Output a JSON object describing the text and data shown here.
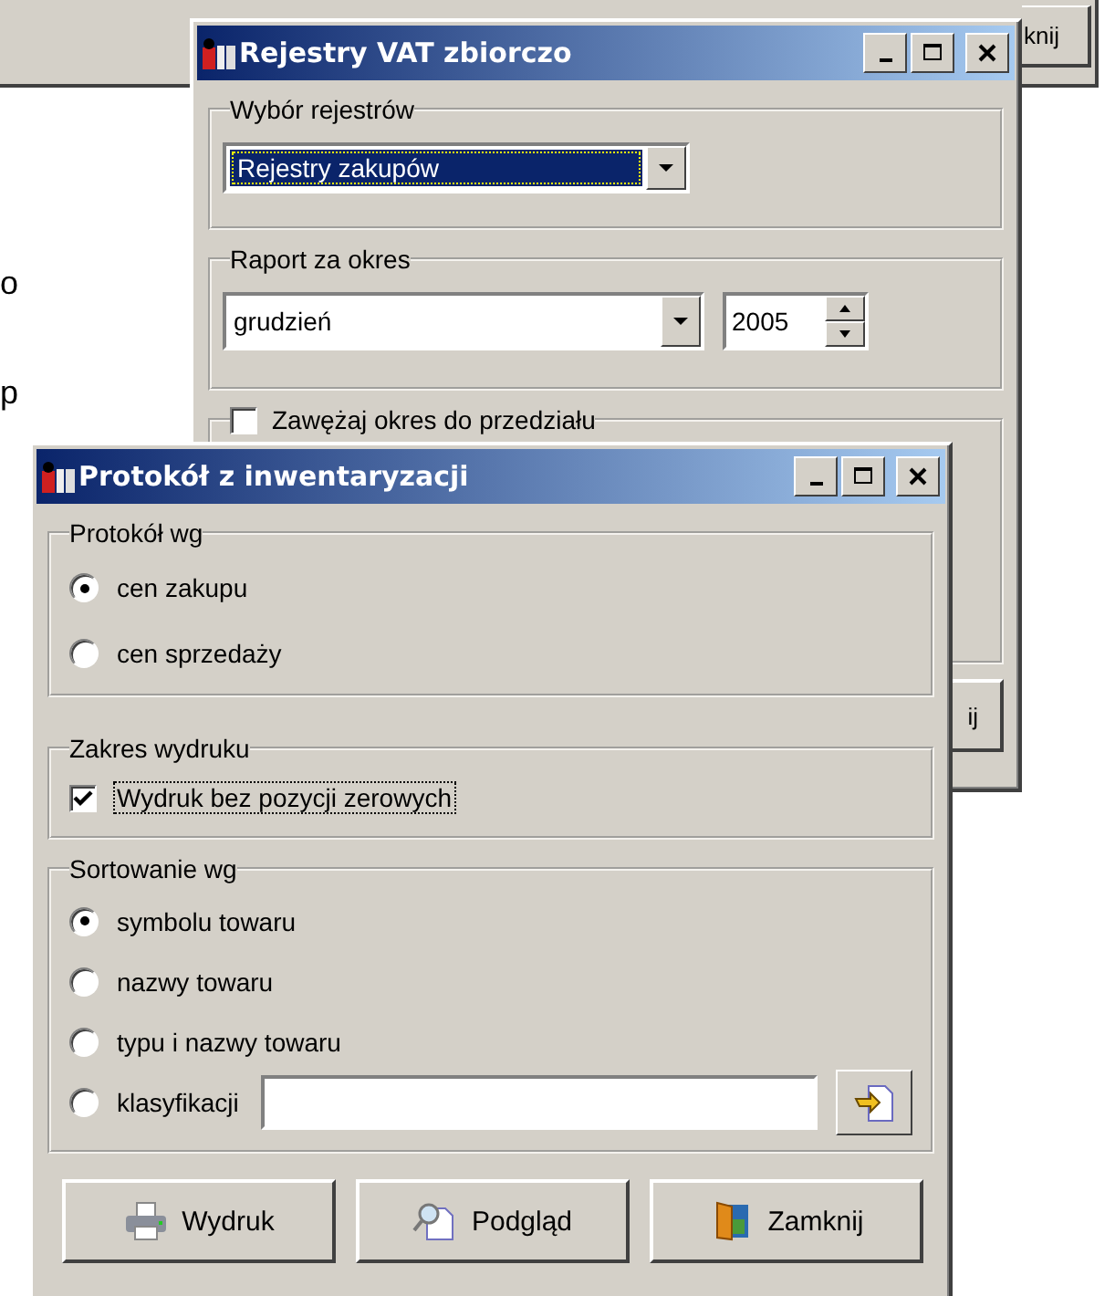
{
  "background": {
    "top_button": "knij",
    "fragments": [
      "o",
      "p"
    ]
  },
  "back_window": {
    "title": "Rejestry VAT zbiorczo",
    "register_group": {
      "label": "Wybór rejestrów",
      "combo": {
        "value": "Rejestry zakupów",
        "selected": true
      }
    },
    "period_group": {
      "label": "Raport za okres",
      "month": {
        "value": "grudzień"
      },
      "year": {
        "value": "2005"
      }
    },
    "range_group": {
      "label": "Zawężaj okres do przedziału",
      "checked": false
    },
    "button": "ij"
  },
  "front_window": {
    "title": "Protokół z inwentaryzacji",
    "groups": [
      {
        "kind": "radios",
        "label": "Protokół wg",
        "options": [
          {
            "kind": "plain",
            "label": "cen zakupu",
            "selected": true
          },
          {
            "kind": "plain",
            "label": "cen sprzedaży",
            "selected": false
          }
        ]
      },
      {
        "kind": "checkbox",
        "label": "Zakres wydruku",
        "option": {
          "label": "Wydruk bez pozycji zerowych",
          "checked": true,
          "focused": true
        }
      },
      {
        "kind": "radios",
        "label": "Sortowanie wg",
        "options": [
          {
            "kind": "plain",
            "label": "symbolu towaru",
            "selected": true
          },
          {
            "kind": "plain",
            "label": "nazwy towaru",
            "selected": false
          },
          {
            "kind": "plain",
            "label": "typu i nazwy towaru",
            "selected": false
          },
          {
            "kind": "field",
            "label": "klasyfikacji",
            "selected": false
          }
        ]
      }
    ],
    "buttons": [
      {
        "label": "Wydruk"
      },
      {
        "label": "Podgląd"
      },
      {
        "label": "Zamknij"
      }
    ]
  }
}
